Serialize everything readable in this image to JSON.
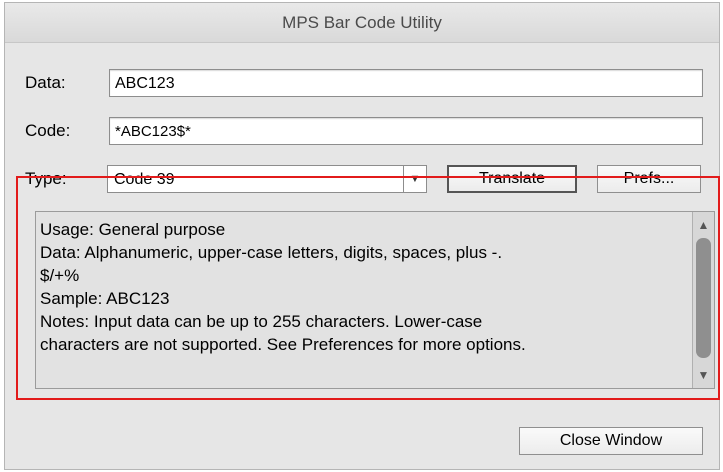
{
  "window": {
    "title": "MPS Bar Code Utility"
  },
  "form": {
    "data_label": "Data:",
    "data_value": "ABC123",
    "code_label": "Code:",
    "code_value": "*ABC123$*",
    "type_label": "Type:",
    "type_value": "Code 39"
  },
  "buttons": {
    "translate": "Translate",
    "prefs": "Prefs...",
    "close": "Close Window"
  },
  "info": {
    "line1": "Usage:   General purpose",
    "line2": "Data:     Alphanumeric, upper-case letters, digits, spaces, plus -.",
    "line3": "$/+%",
    "line4": "Sample:  ABC123",
    "line5": "Notes:   Input data can be up to 255 characters. Lower-case",
    "line6": "characters are not supported. See Preferences for more options."
  },
  "icons": {
    "select_arrow": "chevron-down-icon",
    "scroll_up": "scroll-up-arrow-icon",
    "scroll_down": "scroll-down-arrow-icon"
  },
  "colors": {
    "highlight": "#e21b1b"
  }
}
